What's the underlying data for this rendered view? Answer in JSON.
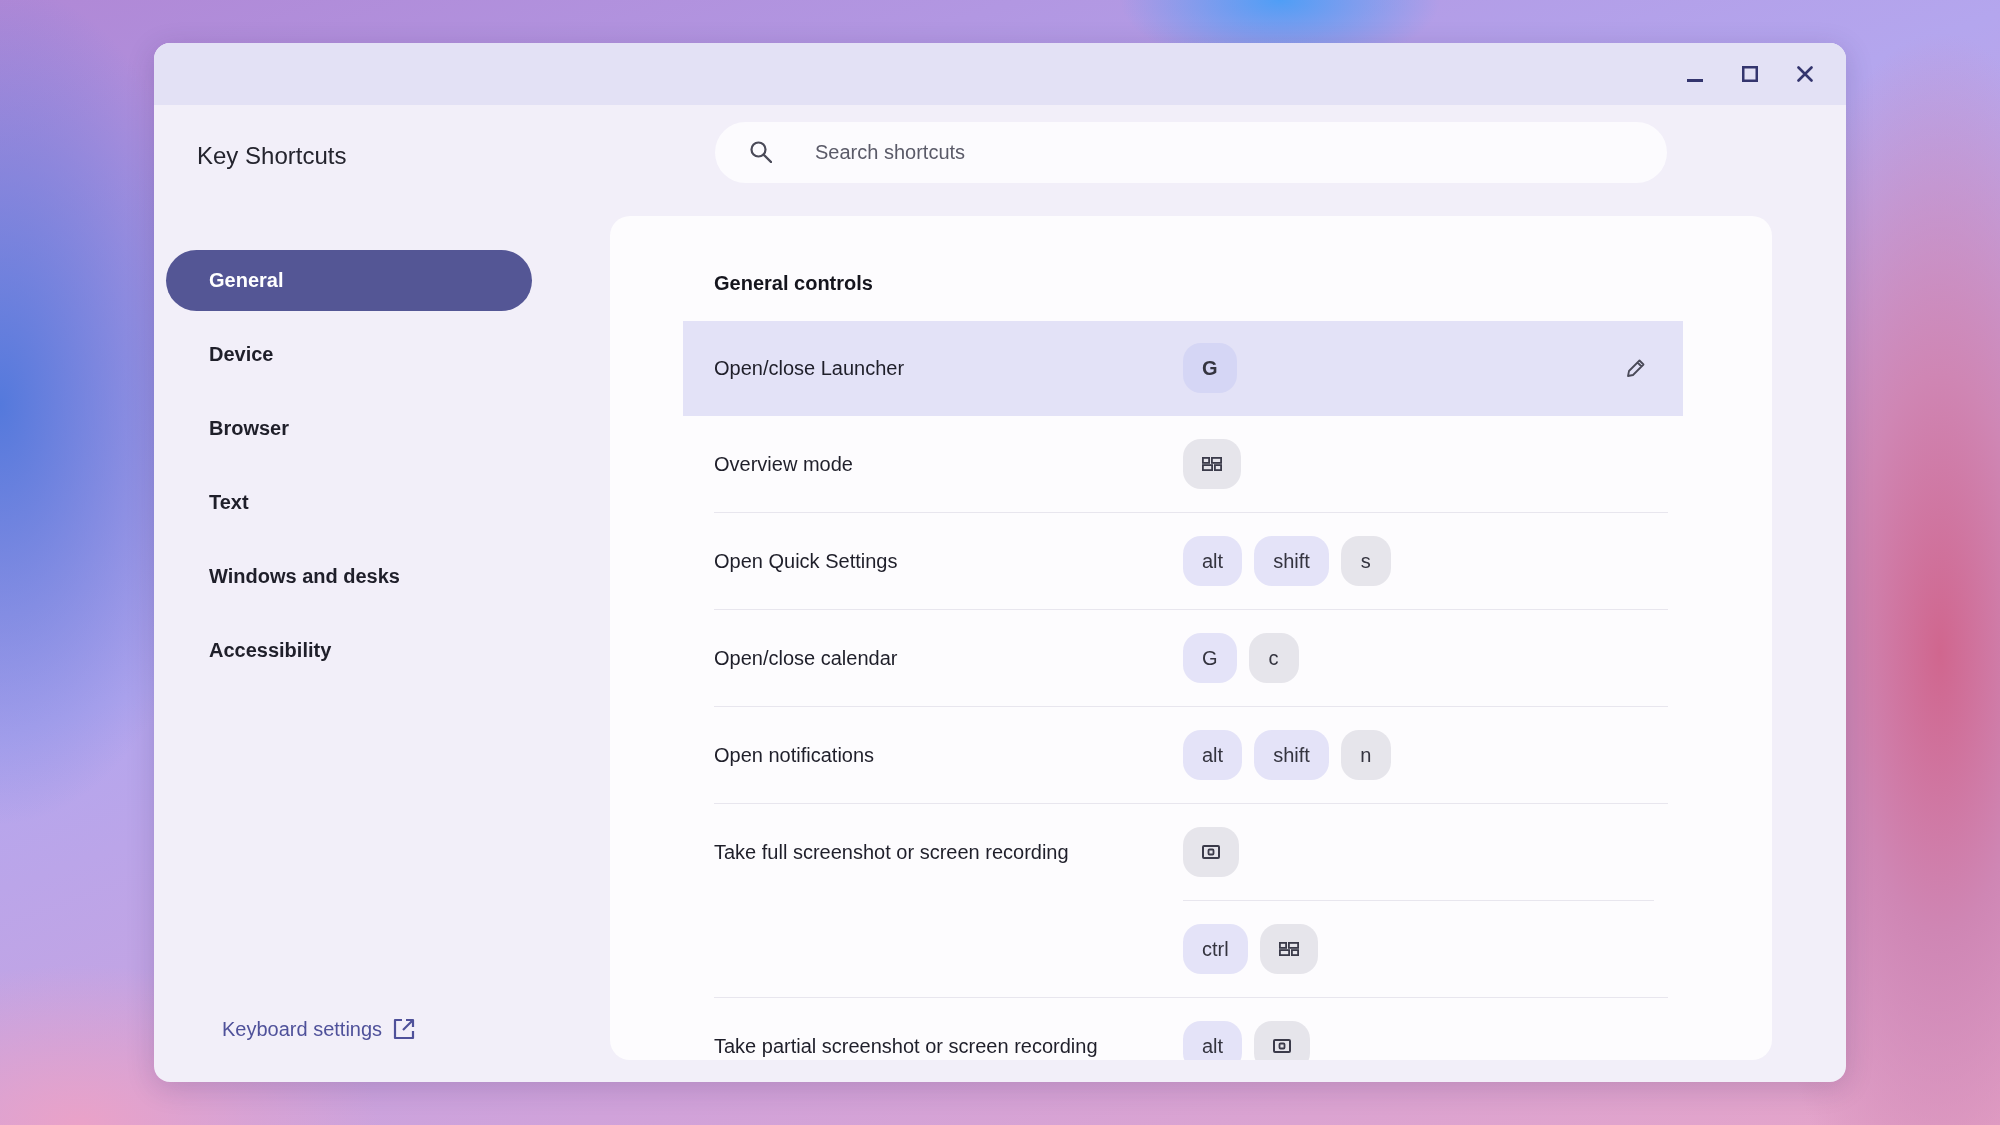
{
  "app": {
    "title": "Key Shortcuts"
  },
  "search": {
    "placeholder": "Search shortcuts"
  },
  "sidebar": {
    "items": [
      {
        "label": "General",
        "selected": true
      },
      {
        "label": "Device",
        "selected": false
      },
      {
        "label": "Browser",
        "selected": false
      },
      {
        "label": "Text",
        "selected": false
      },
      {
        "label": "Windows and desks",
        "selected": false
      },
      {
        "label": "Accessibility",
        "selected": false
      }
    ],
    "link": {
      "label": "Keyboard settings"
    }
  },
  "section": {
    "title": "General controls",
    "rows": [
      {
        "label": "Open/close Launcher",
        "selected": true,
        "combos": [
          [
            {
              "kind": "text",
              "label": "G",
              "modifier": true
            }
          ]
        ]
      },
      {
        "label": "Overview mode",
        "selected": false,
        "combos": [
          [
            {
              "kind": "overview",
              "modifier": false
            }
          ]
        ]
      },
      {
        "label": "Open Quick Settings",
        "selected": false,
        "combos": [
          [
            {
              "kind": "text",
              "label": "alt",
              "modifier": true
            },
            {
              "kind": "text",
              "label": "shift",
              "modifier": true
            },
            {
              "kind": "text",
              "label": "s",
              "modifier": false
            }
          ]
        ]
      },
      {
        "label": "Open/close calendar",
        "selected": false,
        "combos": [
          [
            {
              "kind": "text",
              "label": "G",
              "modifier": true
            },
            {
              "kind": "text",
              "label": "c",
              "modifier": false
            }
          ]
        ]
      },
      {
        "label": "Open notifications",
        "selected": false,
        "combos": [
          [
            {
              "kind": "text",
              "label": "alt",
              "modifier": true
            },
            {
              "kind": "text",
              "label": "shift",
              "modifier": true
            },
            {
              "kind": "text",
              "label": "n",
              "modifier": false
            }
          ]
        ]
      },
      {
        "label": "Take full screenshot or screen recording",
        "selected": false,
        "combos": [
          [
            {
              "kind": "screenshot",
              "modifier": false
            }
          ],
          [
            {
              "kind": "text",
              "label": "ctrl",
              "modifier": true
            },
            {
              "kind": "overview",
              "modifier": false
            }
          ]
        ]
      },
      {
        "label": "Take partial screenshot or screen recording",
        "selected": false,
        "combos": [
          [
            {
              "kind": "text",
              "label": "alt",
              "modifier": true
            },
            {
              "kind": "screenshot",
              "modifier": false
            }
          ]
        ]
      }
    ]
  }
}
